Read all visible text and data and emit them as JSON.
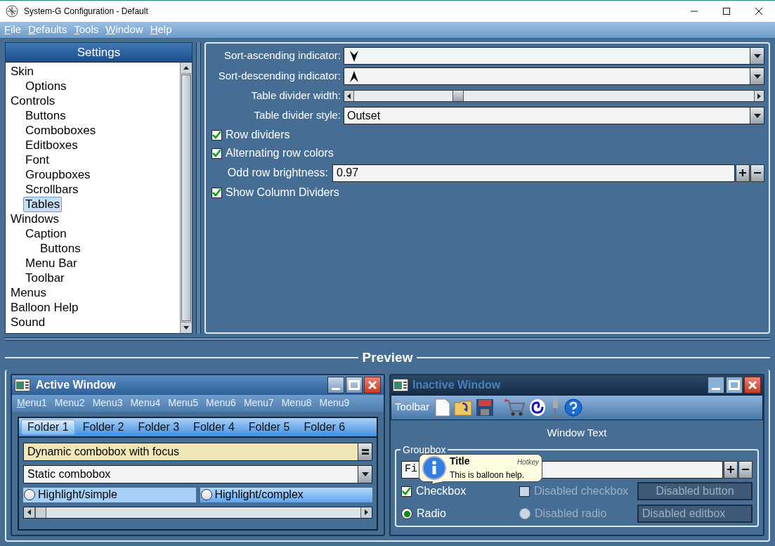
{
  "window": {
    "title": "System-G Configuration - Default"
  },
  "menu_bar": [
    {
      "label": "File",
      "mnemonic": true
    },
    {
      "label": "Defaults",
      "mnemonic": true
    },
    {
      "label": "Tools",
      "mnemonic": true
    },
    {
      "label": "Window",
      "mnemonic": true
    },
    {
      "label": "Help",
      "mnemonic": true
    }
  ],
  "settings": {
    "title": "Settings",
    "tree": [
      {
        "label": "Skin",
        "selected": false,
        "children": [
          {
            "label": "Options",
            "selected": false
          }
        ]
      },
      {
        "label": "Controls",
        "selected": false,
        "children": [
          {
            "label": "Buttons",
            "selected": false
          },
          {
            "label": "Comboboxes",
            "selected": false
          },
          {
            "label": "Editboxes",
            "selected": false
          },
          {
            "label": "Font",
            "selected": false
          },
          {
            "label": "Groupboxes",
            "selected": false
          },
          {
            "label": "Scrollbars",
            "selected": false
          },
          {
            "label": "Tables",
            "selected": true
          }
        ]
      },
      {
        "label": "Windows",
        "selected": false,
        "children": [
          {
            "label": "Caption",
            "selected": false,
            "children": [
              {
                "label": "Buttons",
                "selected": false
              }
            ]
          },
          {
            "label": "Menu Bar",
            "selected": false
          },
          {
            "label": "Toolbar",
            "selected": false
          }
        ]
      },
      {
        "label": "Menus",
        "selected": false
      },
      {
        "label": "Balloon Help",
        "selected": false
      },
      {
        "label": "Sound",
        "selected": false
      }
    ]
  },
  "options": [
    {
      "kind": "ascending",
      "label": "Sort-ascending indicator:"
    },
    {
      "kind": "descending",
      "label": "Sort-descending indicator:"
    },
    {
      "kind": "slider",
      "label": "Table divider width:",
      "level": 0.26
    },
    {
      "kind": "combo",
      "label": "Table divider style:",
      "value": "Outset"
    },
    {
      "kind": "checkbox",
      "label": "Row dividers",
      "checked": true
    },
    {
      "kind": "checkbox",
      "label": "Alternating row colors",
      "checked": true
    },
    {
      "kind": "spinner",
      "label": "Odd row brightness:",
      "value": "0.97"
    },
    {
      "kind": "checkbox",
      "label": "Show Column Dividers",
      "checked": true
    }
  ],
  "preview": {
    "title": "Preview",
    "active_window": {
      "title": "Active Window",
      "menus": [
        {
          "label": "Menu1",
          "mnemonic": true
        },
        {
          "label": "Menu2",
          "mnemonic": false
        },
        {
          "label": "Menu3",
          "mnemonic": false
        },
        {
          "label": "Menu4",
          "mnemonic": false
        },
        {
          "label": "Menu5",
          "mnemonic": false
        },
        {
          "label": "Menu6",
          "mnemonic": false
        },
        {
          "label": "Menu7",
          "mnemonic": false
        },
        {
          "label": "Menu8",
          "mnemonic": false
        },
        {
          "label": "Menu9",
          "mnemonic": false
        }
      ],
      "tabs": [
        {
          "label": "Folder 1",
          "selected": true
        },
        {
          "label": "Folder 2",
          "selected": false
        },
        {
          "label": "Folder 3",
          "selected": false
        },
        {
          "label": "Folder 4",
          "selected": false
        },
        {
          "label": "Folder 5",
          "selected": false
        },
        {
          "label": "Folder 6",
          "selected": false
        }
      ],
      "dynamic_combo": {
        "value": "Dynamic combobox with focus"
      },
      "static_combo": {
        "value": "Static combobox"
      },
      "radios": [
        {
          "label": "Highlight/simple",
          "selected": false,
          "kind": "simple"
        },
        {
          "label": "Highlight/complex",
          "selected": false,
          "kind": "complex"
        }
      ],
      "scrollbar": {
        "level": 0
      }
    },
    "inactive_window": {
      "title": "Inactive Window",
      "toolbar_label": "Toolbar",
      "window_text": "Window Text",
      "groupbox": {
        "title": "Groupbox",
        "edit_value": "Fi",
        "checkbox": {
          "label": "Checkbox",
          "checked": true
        },
        "disabled_checkbox": {
          "label": "Disabled checkbox",
          "checked": false
        },
        "disabled_button": "Disabled button",
        "radio": {
          "label": "Radio",
          "selected": true
        },
        "disabled_radio": {
          "label": "Disabled radio",
          "selected": false
        },
        "disabled_editbox": "Disabled editbox"
      },
      "balloon": {
        "title": "Title",
        "hotkey": "Hotkey",
        "text": "This is balloon help."
      }
    }
  }
}
